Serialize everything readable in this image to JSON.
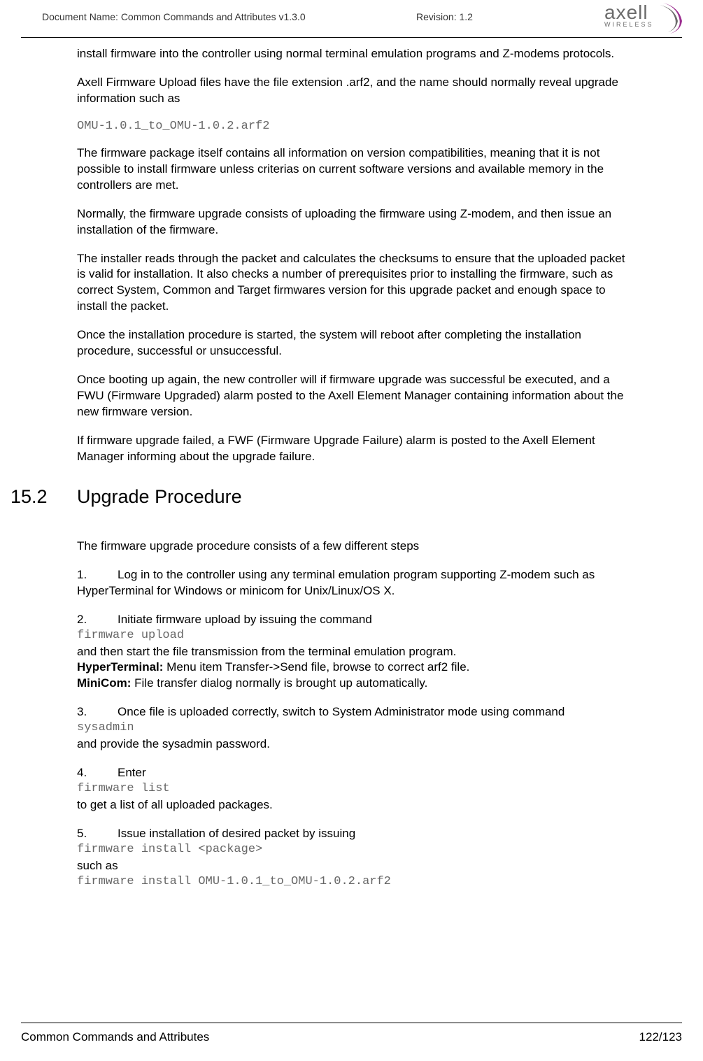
{
  "header": {
    "docName": "Document Name: Common Commands and Attributes v1.3.0",
    "revision": "Revision: 1.2",
    "logoMain": "axell",
    "logoSub": "WIRELESS"
  },
  "paragraphs": {
    "p1": "install firmware into the controller using normal terminal emulation programs and Z-modems protocols.",
    "p2": "Axell Firmware Upload files have the file extension .arf2, and the name should normally reveal upgrade information such as",
    "code1": "OMU-1.0.1_to_OMU-1.0.2.arf2",
    "p3": "The firmware package itself contains all information on version compatibilities, meaning that it is not possible to install firmware unless criterias on current software versions and available memory in the controllers are met.",
    "p4": "Normally, the firmware upgrade consists of uploading the firmware using Z-modem, and then issue an installation of the firmware.",
    "p5": "The installer reads through the packet and calculates the checksums to ensure that the uploaded packet is valid for installation. It also checks a number of prerequisites prior to installing the firmware, such as correct System, Common and Target firmwares version for this upgrade packet and enough space to install the packet.",
    "p6": "Once the installation procedure is started, the system will reboot after completing the installation procedure, successful or unsuccessful.",
    "p7": "Once booting up again, the new controller will if firmware upgrade was successful be executed, and a FWU (Firmware Upgraded) alarm posted to the Axell Element Manager containing information about the new firmware version.",
    "p8": "If firmware upgrade failed, a FWF (Firmware Upgrade Failure) alarm is posted to the Axell Element Manager informing about the upgrade failure."
  },
  "section": {
    "num": "15.2",
    "title": "Upgrade Procedure",
    "intro": "The firmware upgrade procedure consists of a few different steps"
  },
  "steps": {
    "s1_num": "1.",
    "s1_text": "Log in to the controller using any terminal emulation program supporting Z-modem such as HyperTerminal for Windows or minicom for Unix/Linux/OS X.",
    "s2_num": "2.",
    "s2_text": "Initiate firmware upload by issuing the command",
    "s2_code": "firmware upload",
    "s2_after": "and then start the file transmission from the terminal emulation program.",
    "s2_hyper_label": "HyperTerminal:",
    "s2_hyper_text": " Menu item Transfer->Send file, browse to correct arf2 file.",
    "s2_mini_label": "MiniCom:",
    "s2_mini_text": " File transfer dialog normally is brought up automatically.",
    "s3_num": "3.",
    "s3_text": "Once file is uploaded correctly, switch to System Administrator mode using command",
    "s3_code": "sysadmin",
    "s3_after": "and provide the sysadmin password.",
    "s4_num": "4.",
    "s4_text": "Enter",
    "s4_code": "firmware list",
    "s4_after": "to get a list of all uploaded packages.",
    "s5_num": "5.",
    "s5_text": "Issue installation of desired packet by issuing",
    "s5_code": "firmware install <package>",
    "s5_after": "such as",
    "s5_code2": "firmware install OMU-1.0.1_to_OMU-1.0.2.arf2"
  },
  "footer": {
    "left": "Common Commands and Attributes",
    "right": "122/123"
  }
}
